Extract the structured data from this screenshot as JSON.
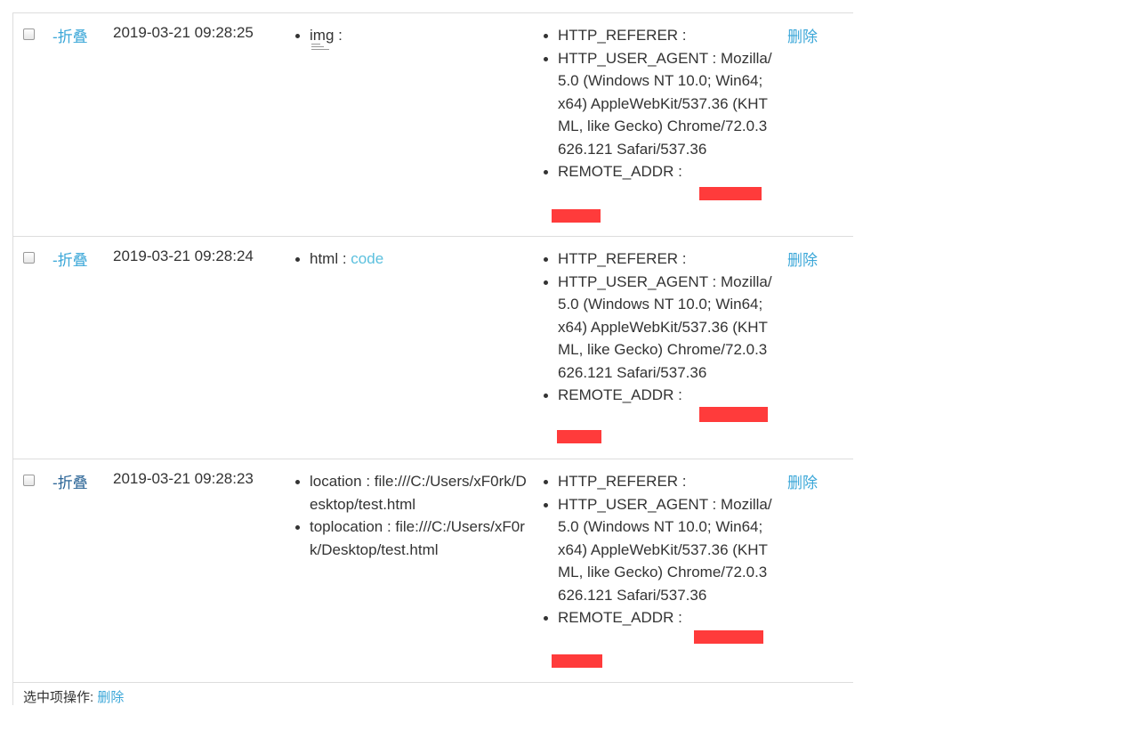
{
  "rows": [
    {
      "fold": "-折叠",
      "time": "2019-03-21 09:28:25",
      "value_items": [
        {
          "key": "img",
          "sep": " : ",
          "value": ""
        }
      ],
      "headers": [
        {
          "key": "HTTP_REFERER",
          "sep": " : ",
          "value": ""
        },
        {
          "key": "HTTP_USER_AGENT",
          "sep": " : ",
          "value": "Mozilla/5.0 (Windows NT 10.0; Win64; x64) AppleWebKit/537.36 (KHTML, like Gecko) Chrome/72.0.3626.121 Safari/537.36"
        },
        {
          "key": "REMOTE_ADDR",
          "sep": " : ",
          "value": ""
        }
      ],
      "delete": "删除"
    },
    {
      "fold": "-折叠",
      "time": "2019-03-21 09:28:24",
      "value_items": [
        {
          "key": "html",
          "sep": " : ",
          "value": "code"
        }
      ],
      "headers": [
        {
          "key": "HTTP_REFERER",
          "sep": " : ",
          "value": ""
        },
        {
          "key": "HTTP_USER_AGENT",
          "sep": " : ",
          "value": "Mozilla/5.0 (Windows NT 10.0; Win64; x64) AppleWebKit/537.36 (KHTML, like Gecko) Chrome/72.0.3626.121 Safari/537.36"
        },
        {
          "key": "REMOTE_ADDR",
          "sep": " : ",
          "value": ""
        }
      ],
      "delete": "删除"
    },
    {
      "fold": "-折叠",
      "time": "2019-03-21 09:28:23",
      "value_items": [
        {
          "key": "location",
          "sep": " : ",
          "value": "file:///C:/Users/xF0rk/Desktop/test.html"
        },
        {
          "key": "toplocation",
          "sep": " : ",
          "value": "file:///C:/Users/xF0rk/Desktop/test.html"
        }
      ],
      "headers": [
        {
          "key": "HTTP_REFERER",
          "sep": " : ",
          "value": ""
        },
        {
          "key": "HTTP_USER_AGENT",
          "sep": " : ",
          "value": "Mozilla/5.0 (Windows NT 10.0; Win64; x64) AppleWebKit/537.36 (KHTML, like Gecko) Chrome/72.0.3626.121 Safari/537.36"
        },
        {
          "key": "REMOTE_ADDR",
          "sep": " : ",
          "value": ""
        }
      ],
      "delete": "删除"
    }
  ],
  "footer": {
    "label": "选中项操作:",
    "action": "删除"
  },
  "colors": {
    "link": "#3ba7d8",
    "redaction": "#ff3b3b",
    "border": "#dddddd"
  }
}
